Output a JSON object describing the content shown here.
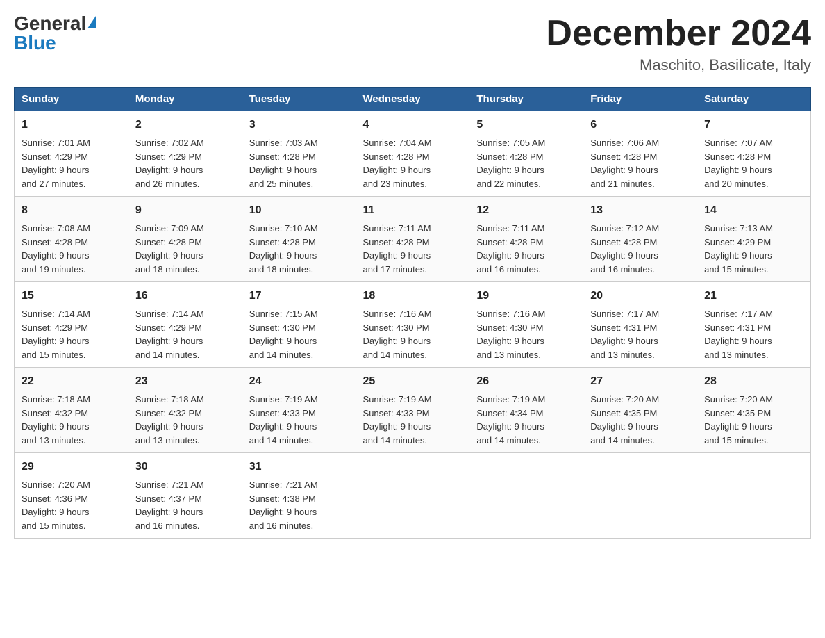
{
  "header": {
    "logo_general": "General",
    "logo_blue": "Blue",
    "month_title": "December 2024",
    "location": "Maschito, Basilicate, Italy"
  },
  "days_of_week": [
    "Sunday",
    "Monday",
    "Tuesday",
    "Wednesday",
    "Thursday",
    "Friday",
    "Saturday"
  ],
  "weeks": [
    [
      {
        "day": "1",
        "sunrise": "7:01 AM",
        "sunset": "4:29 PM",
        "daylight": "9 hours and 27 minutes."
      },
      {
        "day": "2",
        "sunrise": "7:02 AM",
        "sunset": "4:29 PM",
        "daylight": "9 hours and 26 minutes."
      },
      {
        "day": "3",
        "sunrise": "7:03 AM",
        "sunset": "4:28 PM",
        "daylight": "9 hours and 25 minutes."
      },
      {
        "day": "4",
        "sunrise": "7:04 AM",
        "sunset": "4:28 PM",
        "daylight": "9 hours and 23 minutes."
      },
      {
        "day": "5",
        "sunrise": "7:05 AM",
        "sunset": "4:28 PM",
        "daylight": "9 hours and 22 minutes."
      },
      {
        "day": "6",
        "sunrise": "7:06 AM",
        "sunset": "4:28 PM",
        "daylight": "9 hours and 21 minutes."
      },
      {
        "day": "7",
        "sunrise": "7:07 AM",
        "sunset": "4:28 PM",
        "daylight": "9 hours and 20 minutes."
      }
    ],
    [
      {
        "day": "8",
        "sunrise": "7:08 AM",
        "sunset": "4:28 PM",
        "daylight": "9 hours and 19 minutes."
      },
      {
        "day": "9",
        "sunrise": "7:09 AM",
        "sunset": "4:28 PM",
        "daylight": "9 hours and 18 minutes."
      },
      {
        "day": "10",
        "sunrise": "7:10 AM",
        "sunset": "4:28 PM",
        "daylight": "9 hours and 18 minutes."
      },
      {
        "day": "11",
        "sunrise": "7:11 AM",
        "sunset": "4:28 PM",
        "daylight": "9 hours and 17 minutes."
      },
      {
        "day": "12",
        "sunrise": "7:11 AM",
        "sunset": "4:28 PM",
        "daylight": "9 hours and 16 minutes."
      },
      {
        "day": "13",
        "sunrise": "7:12 AM",
        "sunset": "4:28 PM",
        "daylight": "9 hours and 16 minutes."
      },
      {
        "day": "14",
        "sunrise": "7:13 AM",
        "sunset": "4:29 PM",
        "daylight": "9 hours and 15 minutes."
      }
    ],
    [
      {
        "day": "15",
        "sunrise": "7:14 AM",
        "sunset": "4:29 PM",
        "daylight": "9 hours and 15 minutes."
      },
      {
        "day": "16",
        "sunrise": "7:14 AM",
        "sunset": "4:29 PM",
        "daylight": "9 hours and 14 minutes."
      },
      {
        "day": "17",
        "sunrise": "7:15 AM",
        "sunset": "4:30 PM",
        "daylight": "9 hours and 14 minutes."
      },
      {
        "day": "18",
        "sunrise": "7:16 AM",
        "sunset": "4:30 PM",
        "daylight": "9 hours and 14 minutes."
      },
      {
        "day": "19",
        "sunrise": "7:16 AM",
        "sunset": "4:30 PM",
        "daylight": "9 hours and 13 minutes."
      },
      {
        "day": "20",
        "sunrise": "7:17 AM",
        "sunset": "4:31 PM",
        "daylight": "9 hours and 13 minutes."
      },
      {
        "day": "21",
        "sunrise": "7:17 AM",
        "sunset": "4:31 PM",
        "daylight": "9 hours and 13 minutes."
      }
    ],
    [
      {
        "day": "22",
        "sunrise": "7:18 AM",
        "sunset": "4:32 PM",
        "daylight": "9 hours and 13 minutes."
      },
      {
        "day": "23",
        "sunrise": "7:18 AM",
        "sunset": "4:32 PM",
        "daylight": "9 hours and 13 minutes."
      },
      {
        "day": "24",
        "sunrise": "7:19 AM",
        "sunset": "4:33 PM",
        "daylight": "9 hours and 14 minutes."
      },
      {
        "day": "25",
        "sunrise": "7:19 AM",
        "sunset": "4:33 PM",
        "daylight": "9 hours and 14 minutes."
      },
      {
        "day": "26",
        "sunrise": "7:19 AM",
        "sunset": "4:34 PM",
        "daylight": "9 hours and 14 minutes."
      },
      {
        "day": "27",
        "sunrise": "7:20 AM",
        "sunset": "4:35 PM",
        "daylight": "9 hours and 14 minutes."
      },
      {
        "day": "28",
        "sunrise": "7:20 AM",
        "sunset": "4:35 PM",
        "daylight": "9 hours and 15 minutes."
      }
    ],
    [
      {
        "day": "29",
        "sunrise": "7:20 AM",
        "sunset": "4:36 PM",
        "daylight": "9 hours and 15 minutes."
      },
      {
        "day": "30",
        "sunrise": "7:21 AM",
        "sunset": "4:37 PM",
        "daylight": "9 hours and 16 minutes."
      },
      {
        "day": "31",
        "sunrise": "7:21 AM",
        "sunset": "4:38 PM",
        "daylight": "9 hours and 16 minutes."
      },
      null,
      null,
      null,
      null
    ]
  ]
}
